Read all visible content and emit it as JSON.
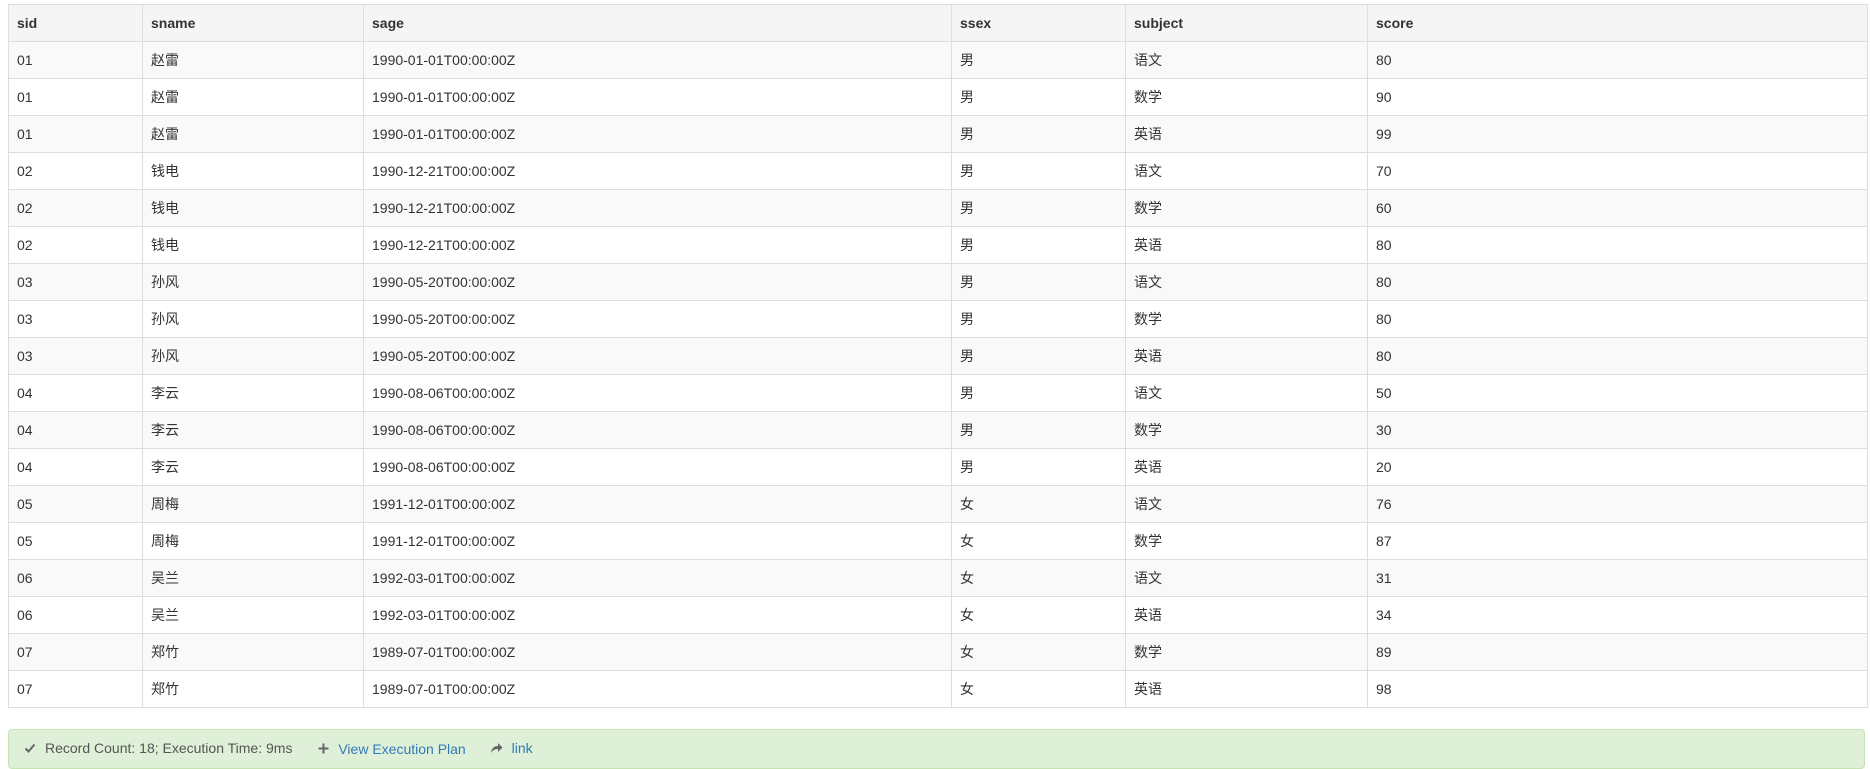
{
  "table": {
    "columns": [
      "sid",
      "sname",
      "sage",
      "ssex",
      "subject",
      "score"
    ],
    "rows": [
      [
        "01",
        "赵雷",
        "1990-01-01T00:00:00Z",
        "男",
        "语文",
        "80"
      ],
      [
        "01",
        "赵雷",
        "1990-01-01T00:00:00Z",
        "男",
        "数学",
        "90"
      ],
      [
        "01",
        "赵雷",
        "1990-01-01T00:00:00Z",
        "男",
        "英语",
        "99"
      ],
      [
        "02",
        "钱电",
        "1990-12-21T00:00:00Z",
        "男",
        "语文",
        "70"
      ],
      [
        "02",
        "钱电",
        "1990-12-21T00:00:00Z",
        "男",
        "数学",
        "60"
      ],
      [
        "02",
        "钱电",
        "1990-12-21T00:00:00Z",
        "男",
        "英语",
        "80"
      ],
      [
        "03",
        "孙风",
        "1990-05-20T00:00:00Z",
        "男",
        "语文",
        "80"
      ],
      [
        "03",
        "孙风",
        "1990-05-20T00:00:00Z",
        "男",
        "数学",
        "80"
      ],
      [
        "03",
        "孙风",
        "1990-05-20T00:00:00Z",
        "男",
        "英语",
        "80"
      ],
      [
        "04",
        "李云",
        "1990-08-06T00:00:00Z",
        "男",
        "语文",
        "50"
      ],
      [
        "04",
        "李云",
        "1990-08-06T00:00:00Z",
        "男",
        "数学",
        "30"
      ],
      [
        "04",
        "李云",
        "1990-08-06T00:00:00Z",
        "男",
        "英语",
        "20"
      ],
      [
        "05",
        "周梅",
        "1991-12-01T00:00:00Z",
        "女",
        "语文",
        "76"
      ],
      [
        "05",
        "周梅",
        "1991-12-01T00:00:00Z",
        "女",
        "数学",
        "87"
      ],
      [
        "06",
        "吴兰",
        "1992-03-01T00:00:00Z",
        "女",
        "语文",
        "31"
      ],
      [
        "06",
        "吴兰",
        "1992-03-01T00:00:00Z",
        "女",
        "英语",
        "34"
      ],
      [
        "07",
        "郑竹",
        "1989-07-01T00:00:00Z",
        "女",
        "数学",
        "89"
      ],
      [
        "07",
        "郑竹",
        "1989-07-01T00:00:00Z",
        "女",
        "英语",
        "98"
      ]
    ]
  },
  "status": {
    "record_info": "Record Count: 18; Execution Time: 9ms",
    "view_plan_label": "View Execution Plan",
    "link_label": "link",
    "icons": {
      "success": "check-icon",
      "plan": "plus-icon",
      "link": "share-icon"
    },
    "colors": {
      "background": "#dff0d8",
      "link": "#337ab7"
    }
  }
}
